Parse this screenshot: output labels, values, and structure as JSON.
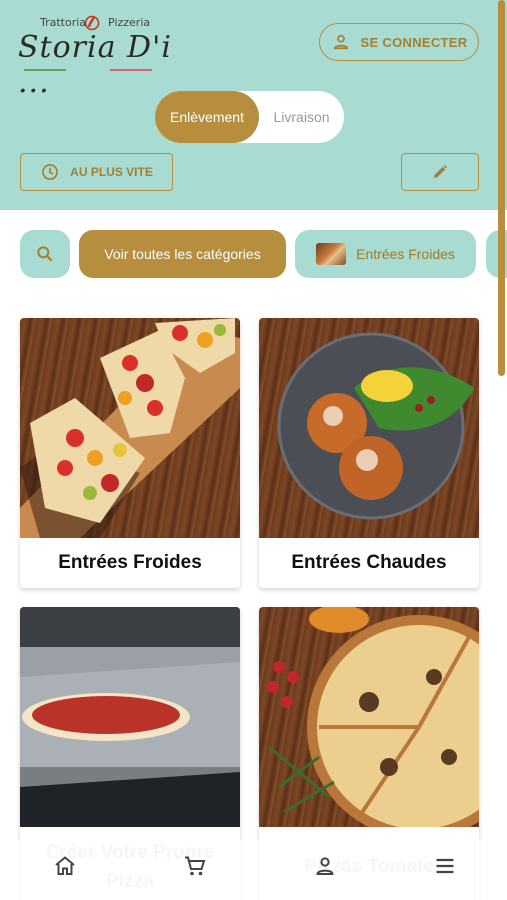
{
  "brand": {
    "logo_top_left": "Trattoria",
    "logo_top_right": "Pizzeria",
    "logo_script": "Storia D'i ..."
  },
  "header": {
    "login_label": "SE CONNECTER",
    "mode_toggle": {
      "selected": "Enlèvement",
      "other": "Livraison"
    },
    "asap_label": "AU PLUS VITE"
  },
  "categories_bar": {
    "all_label": "Voir toutes les catégories",
    "chips": [
      {
        "label": "Entrées Froides"
      }
    ]
  },
  "cards": [
    {
      "title": "Entrées Froides"
    },
    {
      "title": "Entrées Chaudes"
    },
    {
      "title": "Créer Votre Propre Pizza"
    },
    {
      "title": "Pizzas Tomate"
    }
  ],
  "colors": {
    "header_bg": "#a8dcd2",
    "accent_gold": "#b68e3d",
    "text_dark": "#111111"
  },
  "icons": {
    "login": "person-outline-icon",
    "asap": "clock-icon",
    "edit": "pencil-icon",
    "search": "search-icon",
    "nav": [
      "home-icon",
      "cart-icon",
      "person-icon",
      "menu-icon"
    ]
  }
}
